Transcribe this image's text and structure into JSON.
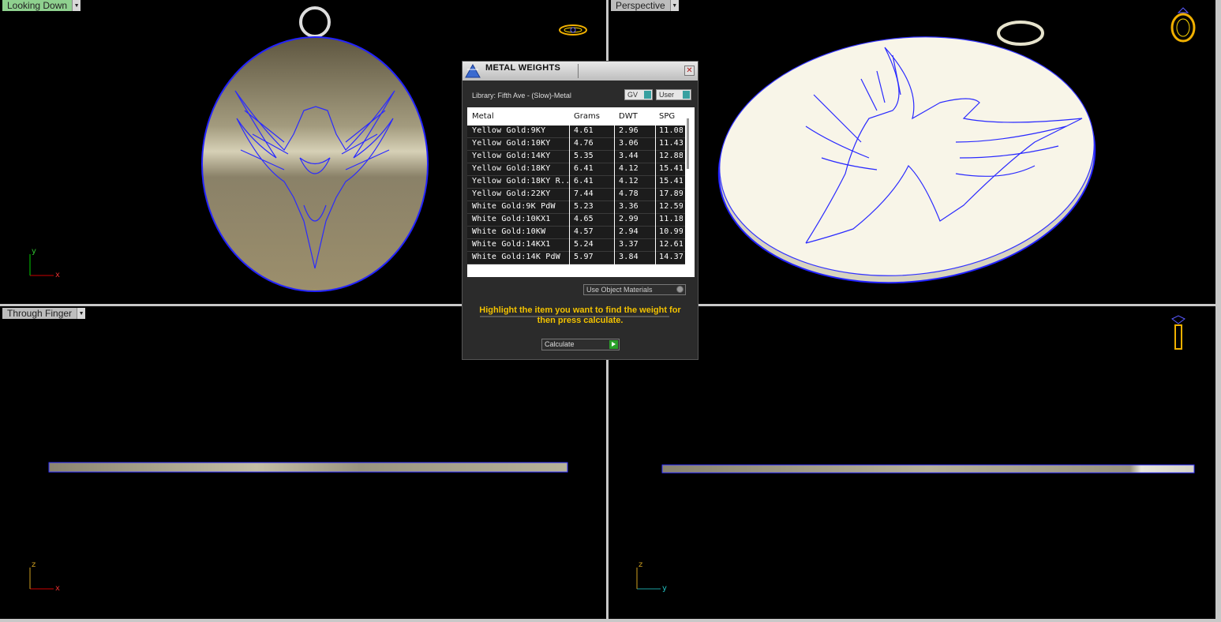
{
  "viewports": {
    "top_left": {
      "label": "Looking Down"
    },
    "top_right": {
      "label": "Perspective"
    },
    "bottom_left": {
      "label": "Through Finger"
    },
    "axes": {
      "x": "x",
      "y": "y",
      "z": "z"
    }
  },
  "dialog": {
    "title": "METAL WEIGHTS",
    "close": "✕",
    "library": "Library: Fifth Ave - (Slow)-Metal",
    "gv_label": "GV",
    "user_label": "User",
    "columns": [
      "Metal",
      "Grams",
      "DWT",
      "SPG"
    ],
    "rows": [
      {
        "metal": "Yellow Gold:9KY",
        "grams": "4.61",
        "dwt": "2.96",
        "spg": "11.08"
      },
      {
        "metal": "Yellow Gold:10KY",
        "grams": "4.76",
        "dwt": "3.06",
        "spg": "11.43"
      },
      {
        "metal": "Yellow Gold:14KY",
        "grams": "5.35",
        "dwt": "3.44",
        "spg": "12.88"
      },
      {
        "metal": "Yellow Gold:18KY",
        "grams": "6.41",
        "dwt": "4.12",
        "spg": "15.41"
      },
      {
        "metal": "Yellow Gold:18KY R...",
        "grams": "6.41",
        "dwt": "4.12",
        "spg": "15.41"
      },
      {
        "metal": "Yellow Gold:22KY",
        "grams": "7.44",
        "dwt": "4.78",
        "spg": "17.89"
      },
      {
        "metal": "White Gold:9K PdW",
        "grams": "5.23",
        "dwt": "3.36",
        "spg": "12.59"
      },
      {
        "metal": "White Gold:10KX1",
        "grams": "4.65",
        "dwt": "2.99",
        "spg": "11.18"
      },
      {
        "metal": "White Gold:10KW",
        "grams": "4.57",
        "dwt": "2.94",
        "spg": "10.99"
      },
      {
        "metal": "White Gold:14KX1",
        "grams": "5.24",
        "dwt": "3.37",
        "spg": "12.61"
      },
      {
        "metal": "White Gold:14K PdW",
        "grams": "5.97",
        "dwt": "3.84",
        "spg": "14.37"
      }
    ],
    "use_object_materials": "Use Object Materials",
    "hint": "Highlight the item you want to find the weight for then press calculate.",
    "calculate": "Calculate"
  },
  "colors": {
    "accent": "#f2c200",
    "wire": "#1a1aff",
    "viewport_bg": "#000000"
  }
}
